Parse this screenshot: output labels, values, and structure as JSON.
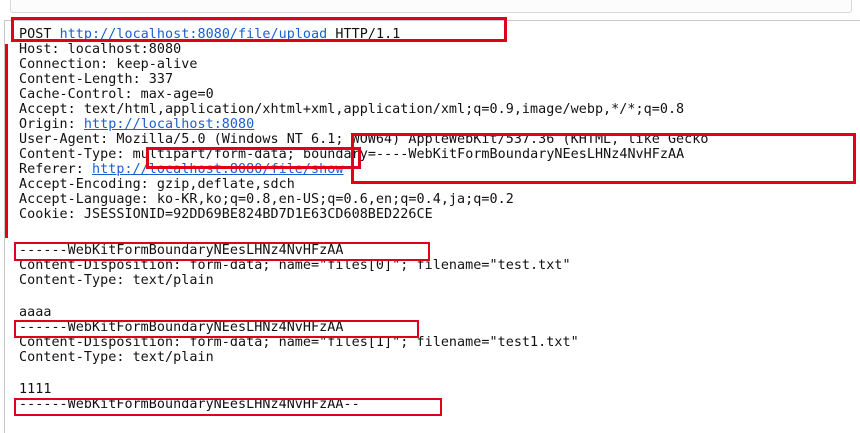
{
  "request_line": {
    "method": "POST",
    "url": "http://localhost:8080/file/upload",
    "version": "HTTP/1.1"
  },
  "headers": {
    "host": "Host: localhost:8080",
    "connection": "Connection: keep-alive",
    "content_length": "Content-Length: 337",
    "cache_control": "Cache-Control: max-age=0",
    "accept": "Accept: text/html,application/xhtml+xml,application/xml;q=0.9,image/webp,*/*;q=0.8",
    "origin_label": "Origin: ",
    "origin_url": "http://localhost:8080",
    "user_agent": "User-Agent: Mozilla/5.0 (Windows NT 6.1; WOW64) AppleWebKit/537.36 (KHTML, like Gecko",
    "content_type_label": "Content-Type:",
    "content_type_value": "multipart/form-data;",
    "content_type_boundary": "boundary=----WebKitFormBoundaryNEesLHNz4NvHFzAA",
    "referer_label": "Referer: ",
    "referer_url": "http://localhost:8080/file/show",
    "accept_encoding": "Accept-Encoding: gzip,deflate,sdch",
    "accept_language": "Accept-Language: ko-KR,ko;q=0.8,en-US;q=0.6,en;q=0.4,ja;q=0.2",
    "cookie": "Cookie: JSESSIONID=92DD69BE824BD7D1E63CD608BED226CE"
  },
  "body": {
    "boundary_1": "------WebKitFormBoundaryNEesLHNz4NvHFzAA",
    "part1_disposition": "Content-Disposition: form-data; name=\"files[0]\"; filename=\"test.txt\"",
    "part1_type": "Content-Type: text/plain",
    "part1_content": "aaaa",
    "boundary_2": "------WebKitFormBoundaryNEesLHNz4NvHFzAA",
    "part2_disposition": "Content-Disposition: form-data; name=\"files[1]\"; filename=\"test1.txt\"",
    "part2_type": "Content-Type: text/plain",
    "part2_content": "1111",
    "boundary_end": "------WebKitFormBoundaryNEesLHNz4NvHFzAA--"
  },
  "colors": {
    "highlight": "#e0001b",
    "link": "#1a5fd0",
    "text": "#111111"
  }
}
